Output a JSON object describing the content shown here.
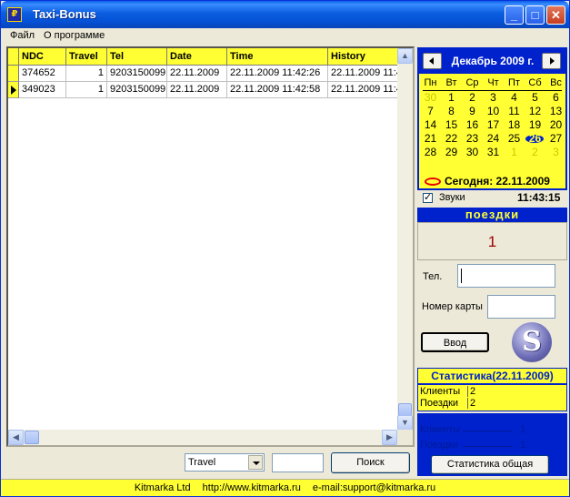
{
  "window": {
    "title": "Taxi-Bonus",
    "icon": "app-icon"
  },
  "menu": [
    "Файл",
    "О программе"
  ],
  "grid": {
    "columns": [
      "NDC",
      "Travel",
      "Tel",
      "Date",
      "Time",
      "History"
    ],
    "rows": [
      {
        "ndc": "374652",
        "travel": "1",
        "tel": "9203150099",
        "date": "22.11.2009",
        "time": "22.11.2009 11:42:26",
        "history": "22.11.2009 11:4",
        "current": false
      },
      {
        "ndc": "349023",
        "travel": "1",
        "tel": "9203150099",
        "date": "22.11.2009",
        "time": "22.11.2009 11:42:58",
        "history": "22.11.2009 11:4",
        "current": true
      }
    ]
  },
  "search": {
    "field_value": "Travel",
    "query": "",
    "button": "Поиск"
  },
  "calendar": {
    "month_label": "Декабрь 2009 г.",
    "weekdays": [
      "Пн",
      "Вт",
      "Ср",
      "Чт",
      "Пт",
      "Сб",
      "Вс"
    ],
    "weeks": [
      [
        "30",
        "1",
        "2",
        "3",
        "4",
        "5",
        "6"
      ],
      [
        "7",
        "8",
        "9",
        "10",
        "11",
        "12",
        "13"
      ],
      [
        "14",
        "15",
        "16",
        "17",
        "18",
        "19",
        "20"
      ],
      [
        "21",
        "22",
        "23",
        "24",
        "25",
        "26",
        "27"
      ],
      [
        "28",
        "29",
        "30",
        "31",
        "1",
        "2",
        "3"
      ]
    ],
    "other_month": [
      [
        0,
        0
      ],
      [
        4,
        4
      ],
      [
        4,
        5
      ],
      [
        4,
        6
      ]
    ],
    "highlighted": [
      3,
      5
    ],
    "today_label": "Сегодня: 22.11.2009"
  },
  "sound": {
    "label": "Звуки",
    "checked": true,
    "clock": "11:43:15"
  },
  "trips": {
    "header": "поездки",
    "value": "1"
  },
  "form": {
    "tel_label": "Тел.",
    "card_label": "Номер карты",
    "enter_button": "Ввод",
    "logo_letter": "S"
  },
  "stats": {
    "header": "Статистика(22.11.2009)",
    "rows": [
      {
        "label": "Клиенты",
        "value": "2"
      },
      {
        "label": "Поездки",
        "value": "2"
      }
    ],
    "blue_rows": [
      {
        "label": "Клиенты",
        "value": "1"
      },
      {
        "label": "Поездки",
        "value": "1"
      }
    ],
    "general_button": "Статистика общая"
  },
  "statusbar": {
    "company": "Kitmarka Ltd",
    "site": "http://www.kitmarka.ru",
    "email": "e-mail:support@kitmarka.ru"
  },
  "colors": {
    "accent_yellow": "#ffff33",
    "accent_blue": "#0022cc",
    "trip_value": "#a00000"
  }
}
